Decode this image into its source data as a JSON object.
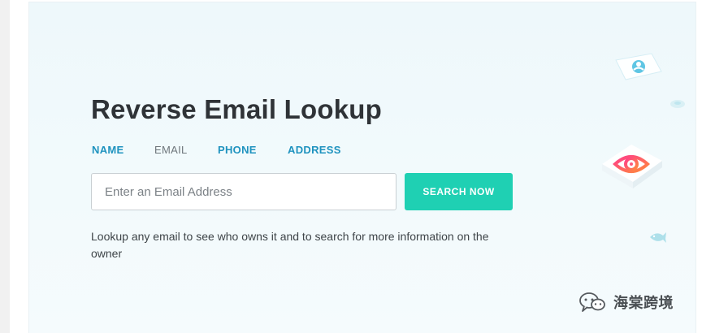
{
  "page": {
    "title": "Reverse Email Lookup",
    "tabs": [
      {
        "label": "NAME",
        "state": "link"
      },
      {
        "label": "EMAIL",
        "state": "active"
      },
      {
        "label": "PHONE",
        "state": "link"
      },
      {
        "label": "ADDRESS",
        "state": "link"
      }
    ],
    "search": {
      "placeholder": "Enter an Email Address",
      "value": "",
      "button_label": "SEARCH NOW"
    },
    "description": "Lookup any email to see who owns it and to search for more information on the owner"
  },
  "decorations": {
    "icons": [
      "user-card-icon",
      "eye-target-card-icon",
      "bubble-icon",
      "fish-icon"
    ]
  },
  "watermark": {
    "label": "海棠跨境",
    "icon": "wechat-icon"
  },
  "colors": {
    "accent": "#1fd0b3",
    "link": "#1f93bf",
    "title": "#2f3337",
    "eye_gradient_start": "#ff3e8a",
    "eye_gradient_end": "#ff8a3c"
  }
}
